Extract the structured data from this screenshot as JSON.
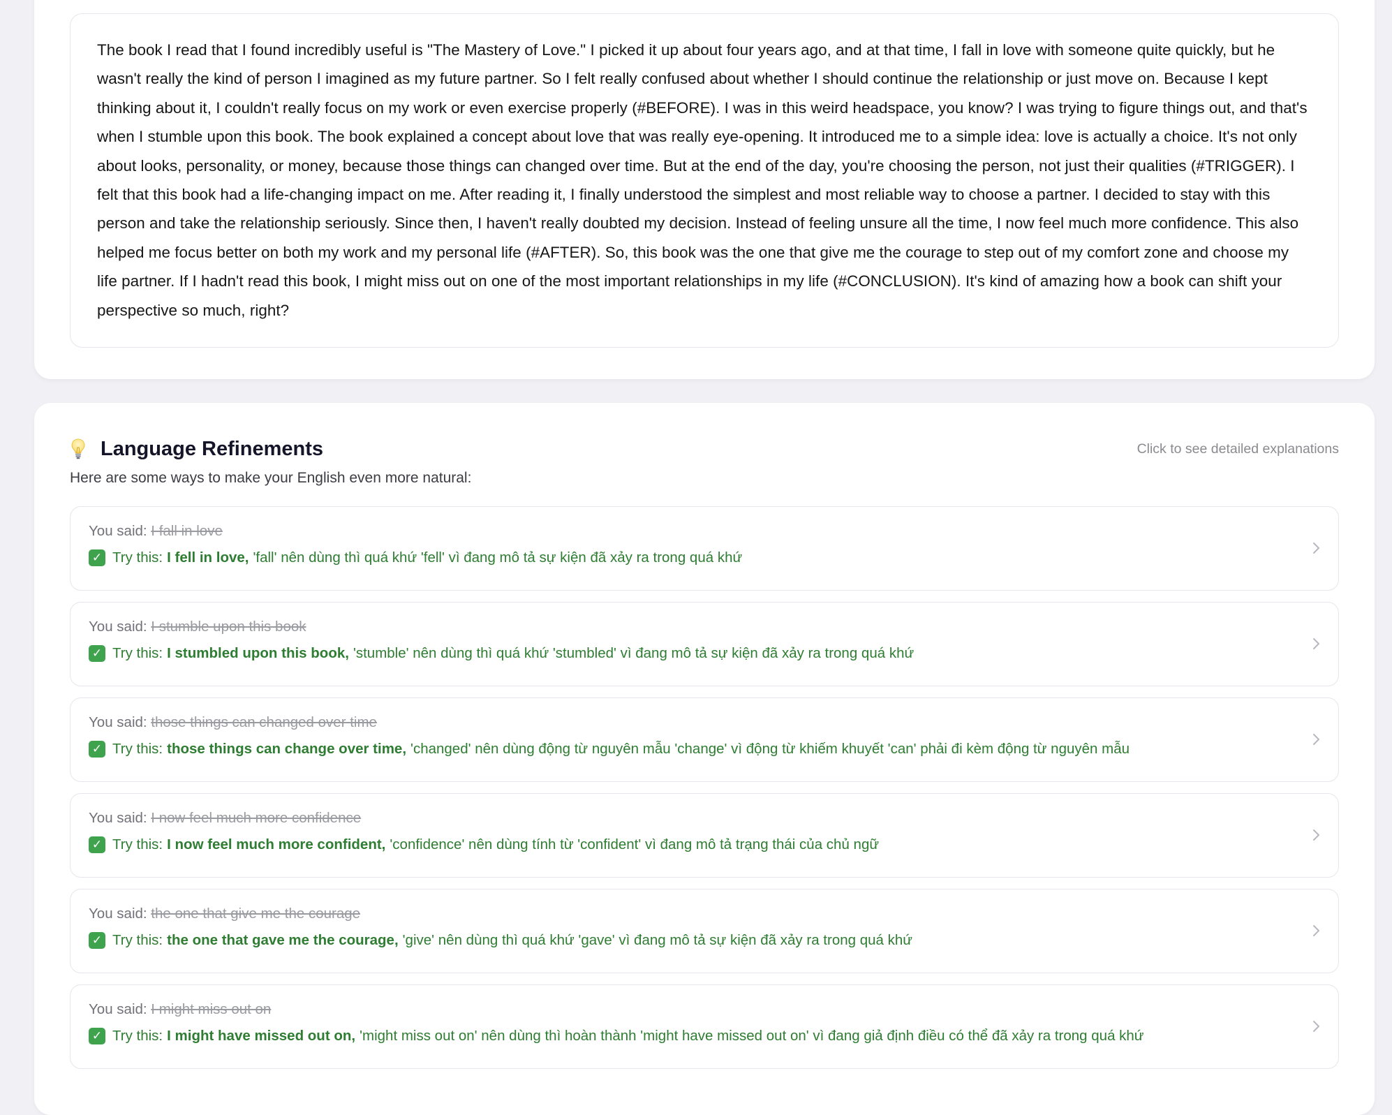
{
  "transcript": {
    "text": "The book I read that I found incredibly useful is \"The Mastery of Love.\" I picked it up about four years ago, and at that time, I fall in love with someone quite quickly, but he wasn't really the kind of person I imagined as my future partner. So I felt really confused about whether I should continue the relationship or just move on. Because I kept thinking about it, I couldn't really focus on my work or even exercise properly (#BEFORE). I was in this weird headspace, you know? I was trying to figure things out, and that's when I stumble upon this book. The book explained a concept about love that was really eye-opening. It introduced me to a simple idea: love is actually a choice. It's not only about looks, personality, or money, because those things can changed over time. But at the end of the day, you're choosing the person, not just their qualities (#TRIGGER). I felt that this book had a life-changing impact on me. After reading it, I finally understood the simplest and most reliable way to choose a partner. I decided to stay with this person and take the relationship seriously. Since then, I haven't really doubted my decision. Instead of feeling unsure all the time, I now feel much more confidence. This also helped me focus better on both my work and my personal life (#AFTER). So, this book was the one that give me the courage to step out of my comfort zone and choose my life partner. If I hadn't read this book, I might miss out on one of the most important relationships in my life (#CONCLUSION). It's kind of amazing how a book can shift your perspective so much, right?"
  },
  "refinements": {
    "title": "Language Refinements",
    "hint": "Click to see detailed explanations",
    "subtitle": "Here are some ways to make your English even more natural:",
    "you_said_label": "You said:",
    "try_label": "Try this:",
    "items": [
      {
        "original": "I fall in love",
        "fix": "I fell in love,",
        "explanation": "'fall' nên dùng thì quá khứ 'fell' vì đang mô tả sự kiện đã xảy ra trong quá khứ"
      },
      {
        "original": "I stumble upon this book",
        "fix": "I stumbled upon this book,",
        "explanation": "'stumble' nên dùng thì quá khứ 'stumbled' vì đang mô tả sự kiện đã xảy ra trong quá khứ"
      },
      {
        "original": "those things can changed over time",
        "fix": "those things can change over time,",
        "explanation": "'changed' nên dùng động từ nguyên mẫu 'change' vì động từ khiếm khuyết 'can' phải đi kèm động từ nguyên mẫu"
      },
      {
        "original": "I now feel much more confidence",
        "fix": "I now feel much more confident,",
        "explanation": "'confidence' nên dùng tính từ 'confident' vì đang mô tả trạng thái của chủ ngữ"
      },
      {
        "original": "the one that give me the courage",
        "fix": "the one that gave me the courage,",
        "explanation": "'give' nên dùng thì quá khứ 'gave' vì đang mô tả sự kiện đã xảy ra trong quá khứ"
      },
      {
        "original": "I might miss out on",
        "fix": "I might have missed out on,",
        "explanation": "'might miss out on' nên dùng thì hoàn thành 'might have missed out on' vì đang giả định điều có thể đã xảy ra trong quá khứ"
      }
    ]
  },
  "colors": {
    "page_background": "#f1f1f5",
    "card_background": "#ffffff",
    "success_green": "#2e7d32",
    "check_green": "#3fa34d",
    "strike_gray": "#9a9aa1"
  },
  "icons": {
    "header": "lightbulb-icon",
    "item_check": "check-icon",
    "item_expand": "chevron-right-icon"
  }
}
